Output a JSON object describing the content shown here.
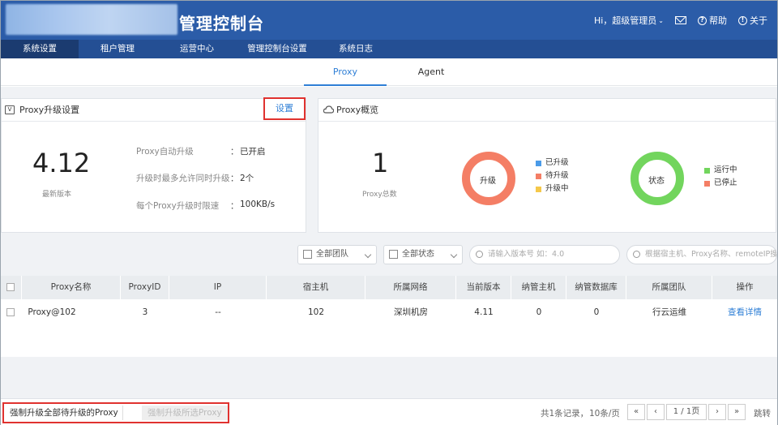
{
  "header": {
    "app_title": "管理控制台",
    "greeting": "Hi，超级管理员",
    "help_label": "帮助",
    "about_label": "关于"
  },
  "nav": {
    "items": [
      {
        "label": "系统设置"
      },
      {
        "label": "租户管理"
      },
      {
        "label": "运营中心"
      },
      {
        "label": "管理控制台设置"
      },
      {
        "label": "系统日志"
      }
    ]
  },
  "tabs": [
    {
      "label": "Proxy"
    },
    {
      "label": "Agent"
    }
  ],
  "upgrade_card": {
    "title": "Proxy升级设置",
    "settings_button": "设置",
    "version": "4.12",
    "version_label": "最新版本",
    "rows": [
      {
        "label": "Proxy自动升级",
        "sep": "：",
        "value": "已开启"
      },
      {
        "label": "升级时最多允许同时升级",
        "sep": "：",
        "value": "2个"
      },
      {
        "label": "每个Proxy升级时限速",
        "sep": "：",
        "value": "100KB/s"
      }
    ]
  },
  "overview_card": {
    "title": "Proxy概览",
    "total": "1",
    "total_label": "Proxy总数",
    "upgrade_donut": {
      "label": "升级",
      "legend": [
        {
          "name": "已升级",
          "color": "#4a9be8"
        },
        {
          "name": "待升级",
          "color": "#f47e65"
        },
        {
          "name": "升级中",
          "color": "#f5c84a"
        }
      ]
    },
    "status_donut": {
      "label": "状态",
      "legend": [
        {
          "name": "运行中",
          "color": "#72d55d"
        },
        {
          "name": "已停止",
          "color": "#f47e65"
        }
      ]
    }
  },
  "filters": {
    "team": "全部团队",
    "status": "全部状态",
    "version_placeholder": "请输入版本号 如：4.0",
    "keyword_placeholder": "根据宿主机、Proxy名称、remoteIP搜"
  },
  "table": {
    "headers": [
      "Proxy名称",
      "ProxyID",
      "IP",
      "宿主机",
      "所属网络",
      "当前版本",
      "纳管主机",
      "纳管数据库",
      "所属团队",
      "操作"
    ],
    "rows": [
      {
        "name": "Proxy@102",
        "id": "3",
        "ip": "--",
        "host": "102",
        "network": "深圳机房",
        "version": "4.11",
        "hosts": "0",
        "dbs": "0",
        "team": "行云运维",
        "action": "查看详情"
      }
    ]
  },
  "bottom": {
    "force_all": "强制升级全部待升级的Proxy",
    "force_selected": "强制升级所选Proxy",
    "record_count": "共1条记录，",
    "page_size": "10条/页",
    "page_info": "1 / 1页",
    "jump": "跳转"
  }
}
